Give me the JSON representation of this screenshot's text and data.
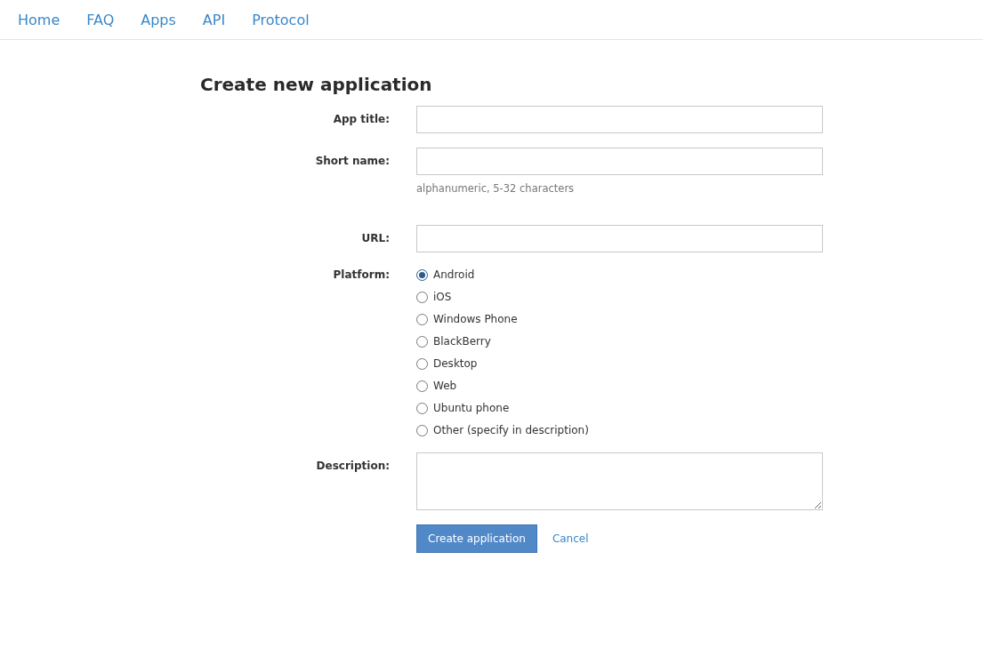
{
  "nav": [
    {
      "label": "Home"
    },
    {
      "label": "FAQ"
    },
    {
      "label": "Apps"
    },
    {
      "label": "API"
    },
    {
      "label": "Protocol"
    }
  ],
  "heading": "Create new application",
  "fields": [
    {
      "label": "App title:",
      "kind": "text"
    },
    {
      "label": "Short name:",
      "kind": "text",
      "hint": "alphanumeric, 5-32 characters"
    },
    {
      "label": "URL:",
      "kind": "text"
    },
    {
      "label": "Platform:",
      "kind": "radio",
      "options": [
        {
          "label": "Android",
          "selected": true
        },
        {
          "label": "iOS",
          "selected": false
        },
        {
          "label": "Windows Phone",
          "selected": false
        },
        {
          "label": "BlackBerry",
          "selected": false
        },
        {
          "label": "Desktop",
          "selected": false
        },
        {
          "label": "Web",
          "selected": false
        },
        {
          "label": "Ubuntu phone",
          "selected": false
        },
        {
          "label": "Other (specify in description)",
          "selected": false
        }
      ]
    },
    {
      "label": "Description:",
      "kind": "textarea"
    }
  ],
  "submit": "Create application",
  "cancel": "Cancel"
}
